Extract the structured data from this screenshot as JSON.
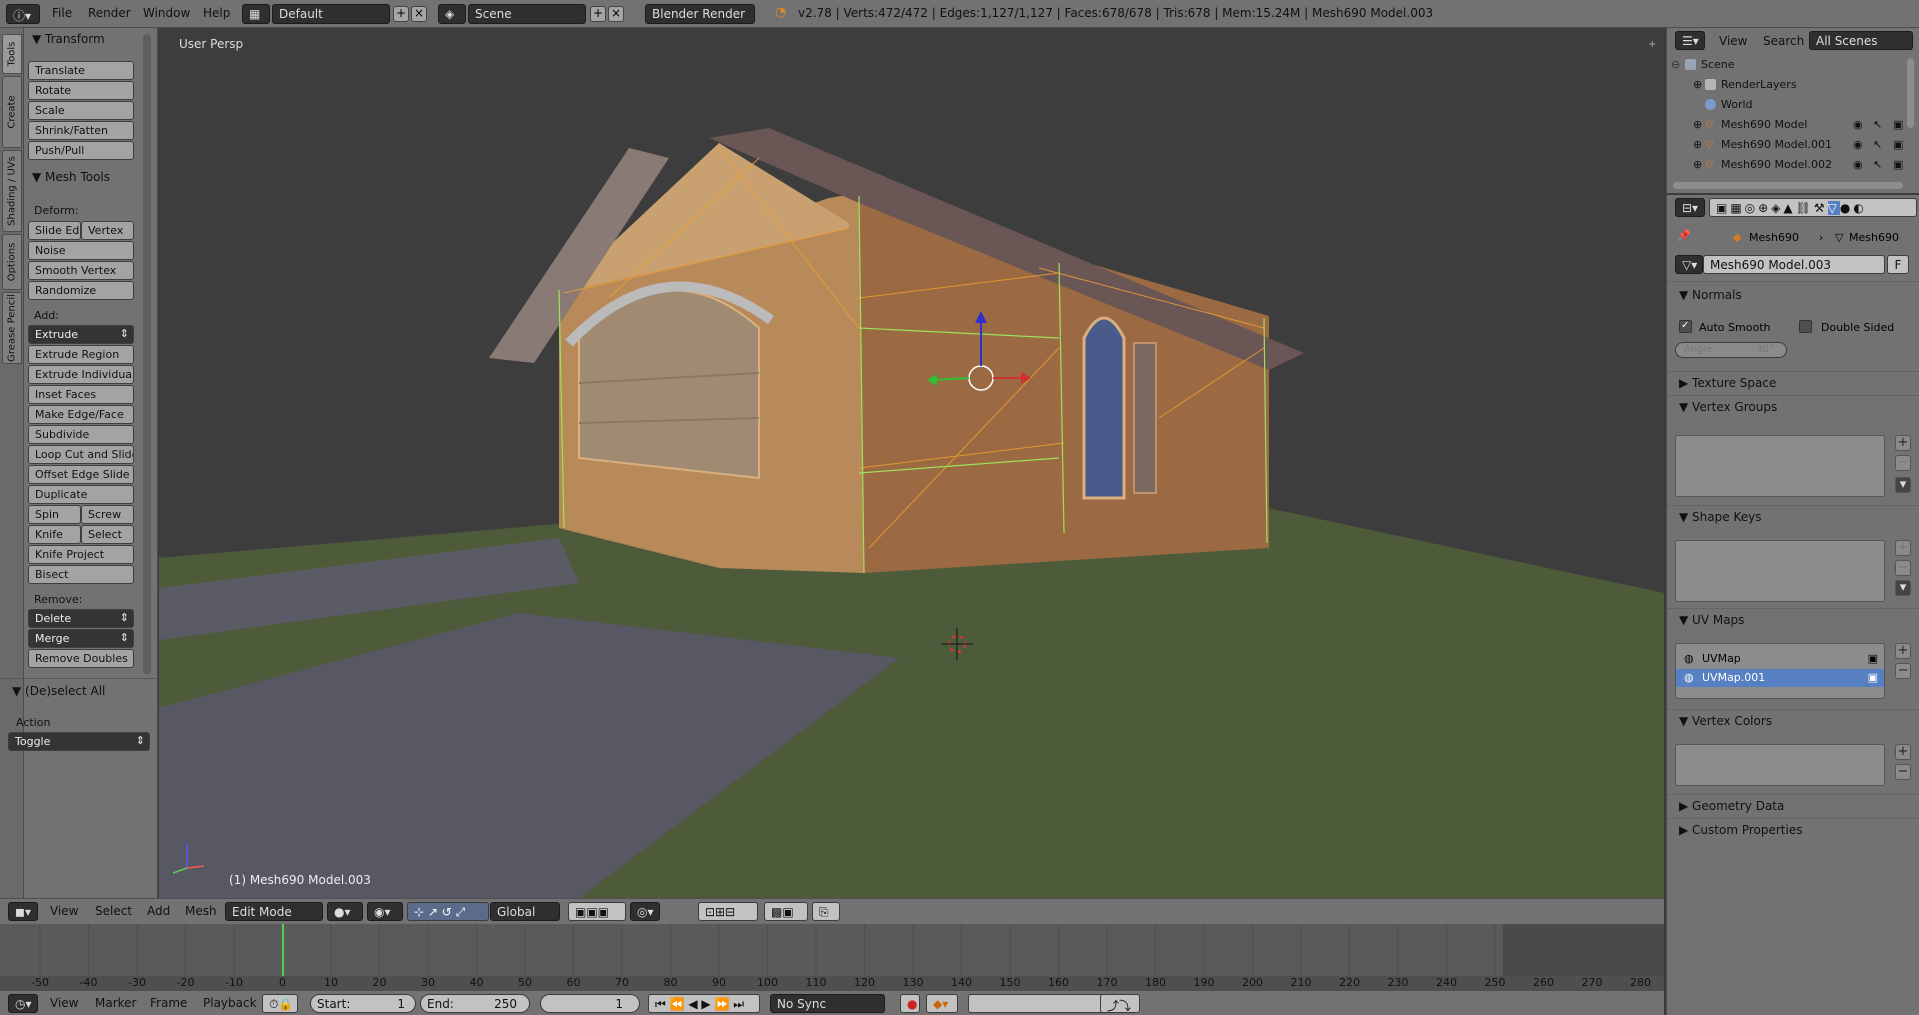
{
  "topbar": {
    "menus": [
      "File",
      "Render",
      "Window",
      "Help"
    ],
    "layout": "Default",
    "scene": "Scene",
    "engine": "Blender Render",
    "stats": "v2.78 | Verts:472/472 | Edges:1,127/1,127 | Faces:678/678 | Tris:678 | Mem:15.24M | Mesh690 Model.003"
  },
  "tabs": [
    "Tools",
    "Create",
    "Shading / UVs",
    "Options",
    "Grease Pencil"
  ],
  "toolshelf": {
    "transform": {
      "title": "Transform",
      "buttons": [
        "Translate",
        "Rotate",
        "Scale",
        "Shrink/Fatten",
        "Push/Pull"
      ]
    },
    "mesh_tools": {
      "title": "Mesh Tools",
      "deform_label": "Deform:",
      "slide_edge": "Slide Ed",
      "vertex": "Vertex",
      "noise": "Noise",
      "smooth_vertex": "Smooth Vertex",
      "randomize": "Randomize",
      "add_label": "Add:",
      "extrude": "Extrude",
      "add_buttons": [
        "Extrude Region",
        "Extrude Individual",
        "Inset Faces",
        "Make Edge/Face",
        "Subdivide",
        "Loop Cut and Slide",
        "Offset Edge Slide",
        "Duplicate"
      ],
      "spin": "Spin",
      "screw": "Screw",
      "knife": "Knife",
      "select": "Select",
      "knife_project": "Knife Project",
      "bisect": "Bisect",
      "remove_label": "Remove:",
      "delete": "Delete",
      "merge": "Merge",
      "remove_doubles": "Remove Doubles"
    },
    "deselect": {
      "title": "(De)select All",
      "action_label": "Action",
      "action_value": "Toggle"
    }
  },
  "viewport": {
    "view_label": "User Persp",
    "object_label": "(1) Mesh690 Model.003"
  },
  "header3d": {
    "menus": [
      "View",
      "Select",
      "Add",
      "Mesh"
    ],
    "mode": "Edit Mode",
    "orientation": "Global"
  },
  "timeline": {
    "ticks": [
      "-50",
      "-40",
      "-30",
      "-20",
      "-10",
      "0",
      "10",
      "20",
      "30",
      "40",
      "50",
      "60",
      "70",
      "80",
      "90",
      "100",
      "110",
      "120",
      "130",
      "140",
      "150",
      "160",
      "170",
      "180",
      "190",
      "200",
      "210",
      "220",
      "230",
      "240",
      "250",
      "260",
      "270",
      "280"
    ],
    "current_frame_value": 0
  },
  "timeline_header": {
    "menus": [
      "View",
      "Marker",
      "Frame",
      "Playback"
    ],
    "start_label": "Start:",
    "start_value": "1",
    "end_label": "End:",
    "end_value": "250",
    "current": "1",
    "sync": "No Sync"
  },
  "outliner": {
    "menus": [
      "View",
      "Search"
    ],
    "filter": "All Scenes",
    "rows": [
      "Scene",
      "RenderLayers",
      "World",
      "Mesh690 Model",
      "Mesh690 Model.001",
      "Mesh690 Model.002"
    ]
  },
  "properties": {
    "breadcrumb_1": "Mesh690",
    "breadcrumb_2": "Mesh690",
    "datablock": "Mesh690 Model.003",
    "fake_user": "F",
    "normals": "Normals",
    "auto_smooth": "Auto Smooth",
    "double_sided": "Double Sided",
    "angle": "Angle:",
    "angle_value": "30°",
    "texture_space": "Texture Space",
    "vertex_groups": "Vertex Groups",
    "shape_keys": "Shape Keys",
    "uv_maps": "UV Maps",
    "uv_items": [
      "UVMap",
      "UVMap.001"
    ],
    "vertex_colors": "Vertex Colors",
    "geometry_data": "Geometry Data",
    "custom_properties": "Custom Properties"
  },
  "colors": {
    "selection": "#5680c2",
    "wire": "#f0a030",
    "edge_highlight": "#9fe05a",
    "ground": "#4e5b3a",
    "road": "#585864"
  }
}
